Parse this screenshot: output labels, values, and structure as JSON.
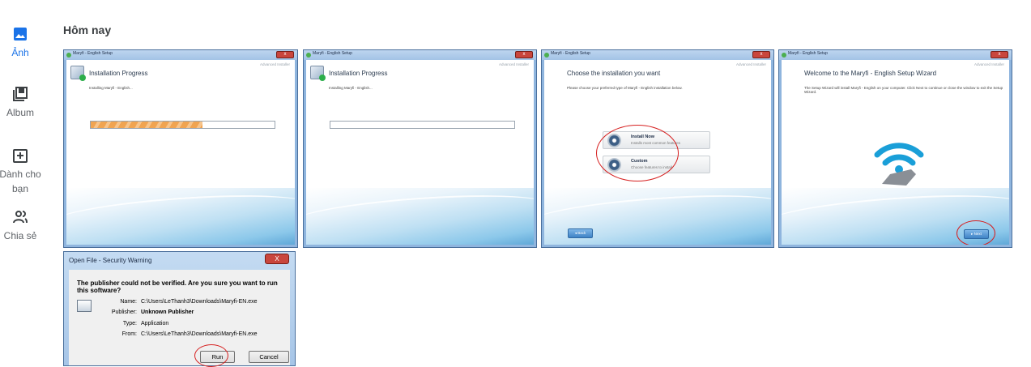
{
  "nav": {
    "items": [
      {
        "label": "Ảnh",
        "icon": "photo-icon",
        "active": true
      },
      {
        "label": "Album",
        "icon": "album-icon",
        "active": false
      },
      {
        "label": "Dành cho bạn",
        "icon": "for-you-icon",
        "active": false
      },
      {
        "label": "Chia sẻ",
        "icon": "share-icon",
        "active": false
      }
    ]
  },
  "main": {
    "section_title": "Hôm nay",
    "photos": [
      {
        "window_title": "Maryfi - English Setup",
        "brand": "Advanced Installer",
        "heading": "Installation Progress",
        "status": "Installing Maryfi - English...",
        "progress": 0.61
      },
      {
        "window_title": "Maryfi - English Setup",
        "brand": "Advanced Installer",
        "heading": "Installation Progress",
        "status": "Installing Maryfi - English...",
        "progress": 0
      },
      {
        "window_title": "Maryfi - English Setup",
        "brand": "Advanced Installer",
        "heading": "Choose the installation you want",
        "instruction": "Please choose your preferred type of Maryfi - English installation below.",
        "options": [
          {
            "title": "Install Now",
            "desc": "Installs most common features"
          },
          {
            "title": "Custom",
            "desc": "Choose features to install"
          }
        ],
        "back_label": "Back"
      },
      {
        "window_title": "Maryfi - English Setup",
        "brand": "Advanced Installer",
        "heading": "Welcome to the Maryfi - English Setup Wizard",
        "instruction": "The Setup Wizard will install Maryfi - English on your computer. Click Next to continue or close the window to exit the Setup Wizard.",
        "next_label": "Next"
      }
    ],
    "security_dialog": {
      "title": "Open File - Security Warning",
      "close_glyph": "X",
      "question": "The publisher could not be verified.  Are you sure you want to run this software?",
      "fields": [
        {
          "key": "Name:",
          "value": "C:\\Users\\LeThanh3\\Downloads\\Maryfi-EN.exe",
          "bold": false
        },
        {
          "key": "Publisher:",
          "value": "Unknown Publisher",
          "bold": true
        },
        {
          "key": "Type:",
          "value": "Application",
          "bold": false
        },
        {
          "key": "From:",
          "value": "C:\\Users\\LeThanh3\\Downloads\\Maryfi-EN.exe",
          "bold": false
        }
      ],
      "run_label": "Run",
      "cancel_label": "Cancel"
    }
  },
  "colors": {
    "accent": "#1a73e8",
    "annotation": "#d61f1f",
    "progress": "#f0a451"
  }
}
